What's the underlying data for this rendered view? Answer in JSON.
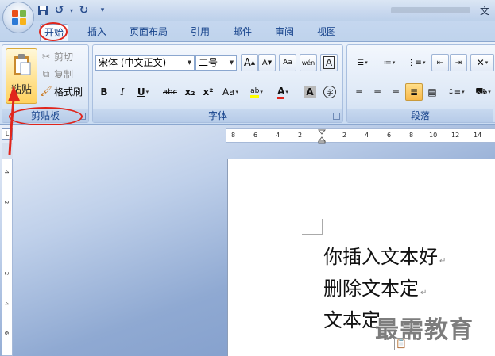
{
  "titlebar": {
    "title_fragment": "文",
    "qat": {
      "save": "💾",
      "undo": "↺",
      "redo": "↻",
      "customize": "▾"
    }
  },
  "tabs": [
    {
      "label": "开始",
      "active": true
    },
    {
      "label": "插入"
    },
    {
      "label": "页面布局"
    },
    {
      "label": "引用"
    },
    {
      "label": "邮件"
    },
    {
      "label": "审阅"
    },
    {
      "label": "视图"
    }
  ],
  "clipboard": {
    "paste_label": "粘贴",
    "cut_label": "剪切",
    "copy_label": "复制",
    "format_painter_label": "格式刷",
    "group_label": "剪贴板"
  },
  "font": {
    "font_name": "宋体 (中文正文)",
    "font_size": "二号",
    "grow": "A",
    "shrink": "A",
    "clear_format": "Aa",
    "phonetic": "wén",
    "char_border": "A",
    "bold": "B",
    "italic": "I",
    "underline": "U",
    "strikethrough": "abc",
    "subscript": "x₂",
    "superscript": "x²",
    "change_case": "Aa",
    "highlight": "ab",
    "font_color": "A",
    "char_shading": "A",
    "enclosed": "字",
    "group_label": "字体"
  },
  "paragraph": {
    "group_label": "段落"
  },
  "ruler": {
    "corner": "L",
    "h_labels": [
      "8",
      "6",
      "4",
      "2",
      "2",
      "4",
      "6",
      "8",
      "10",
      "12",
      "14"
    ],
    "v_labels": [
      "4",
      "2",
      "2",
      "4",
      "6"
    ]
  },
  "document": {
    "lines": [
      "你插入文本好",
      "删除文本定",
      "文本定"
    ],
    "paragraph_mark": "↵"
  },
  "watermark": "最需教育",
  "colors": {
    "accent": "#15428b",
    "annotation": "#e0251c",
    "paste_gold": "#ffd25e"
  }
}
